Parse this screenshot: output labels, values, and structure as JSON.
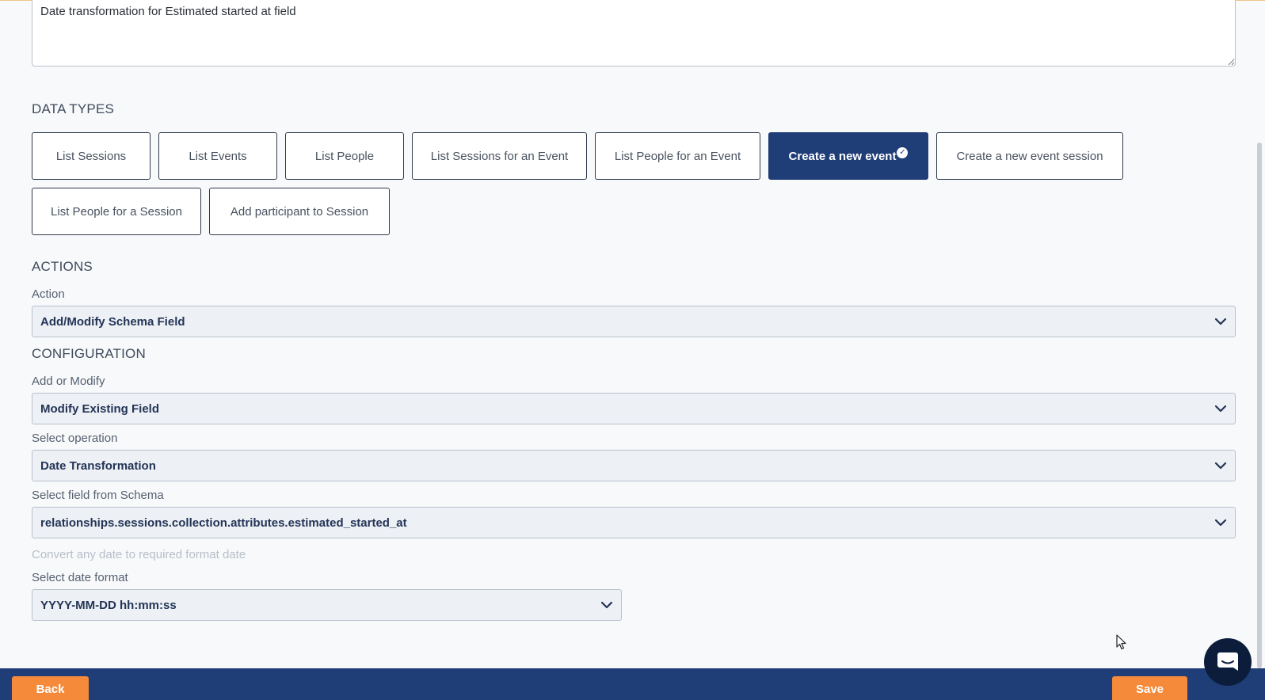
{
  "description": {
    "value": "Date transformation for Estimated started at field"
  },
  "data_types": {
    "title": "DATA TYPES",
    "items": [
      {
        "label": "List Sessions",
        "active": false
      },
      {
        "label": "List Events",
        "active": false
      },
      {
        "label": "List People",
        "active": false
      },
      {
        "label": "List Sessions for an Event",
        "active": false
      },
      {
        "label": "List People for an Event",
        "active": false
      },
      {
        "label": "Create a new event",
        "active": true
      },
      {
        "label": "Create a new event session",
        "active": false
      },
      {
        "label": "List People for a Session",
        "active": false
      },
      {
        "label": "Add participant to Session",
        "active": false
      }
    ]
  },
  "actions": {
    "title": "ACTIONS",
    "action_label": "Action",
    "action_value": "Add/Modify Schema Field"
  },
  "configuration": {
    "title": "CONFIGURATION",
    "add_modify_label": "Add or Modify",
    "add_modify_value": "Modify Existing Field",
    "operation_label": "Select operation",
    "operation_value": "Date Transformation",
    "field_label": "Select field from Schema",
    "field_value": "relationships.sessions.collection.attributes.estimated_started_at",
    "hint": "Convert any date to required format date",
    "date_format_label": "Select date format",
    "date_format_value": "YYYY-MM-DD hh:mm:ss"
  },
  "footer": {
    "back_label": "Back",
    "save_label": "Save"
  },
  "colors": {
    "primary": "#1f3d76",
    "accent": "#f58a3a",
    "select_bg": "#edf0f5"
  },
  "icons": {
    "chevron": "chevron-down-icon",
    "check": "check-circle-icon",
    "chat": "chat-icon",
    "cursor": "mouse-cursor-icon"
  }
}
